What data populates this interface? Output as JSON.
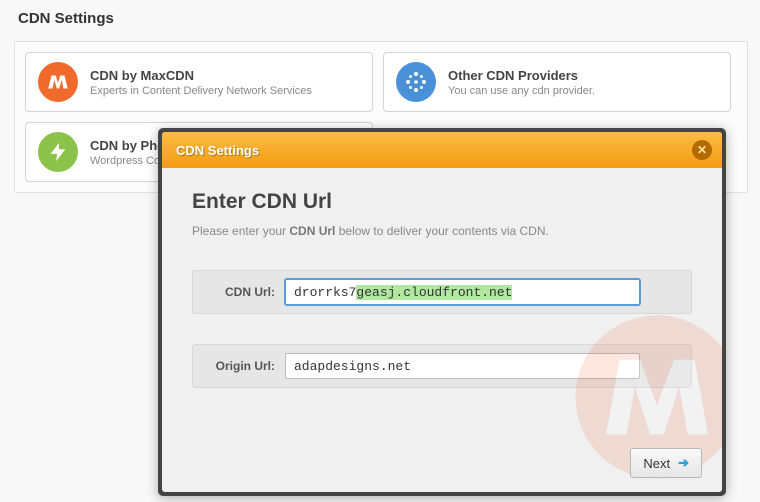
{
  "pageTitle": "CDN Settings",
  "providers": [
    {
      "title": "CDN by MaxCDN",
      "sub": "Experts in Content Delivery Network Services",
      "iconClass": "icon-maxcdn",
      "svg": "m"
    },
    {
      "title": "Other CDN Providers",
      "sub": "You can use any cdn provider.",
      "iconClass": "icon-other",
      "svg": "dots"
    },
    {
      "title": "CDN by Photon",
      "sub": "Wordpress Content Delivery",
      "iconClass": "icon-photon",
      "svg": "bolt"
    }
  ],
  "modal": {
    "title": "CDN Settings",
    "heading": "Enter CDN Url",
    "descPre": "Please enter your ",
    "descBold": "CDN Url",
    "descPost": " below to deliver your contents via CDN.",
    "cdnLabel": "CDN Url:",
    "cdnPrefix": "drorrks7",
    "cdnHighlighted": "geasj.cloudfront.net",
    "originLabel": "Origin Url:",
    "originValue": "adapdesigns.net",
    "nextLabel": "Next"
  }
}
